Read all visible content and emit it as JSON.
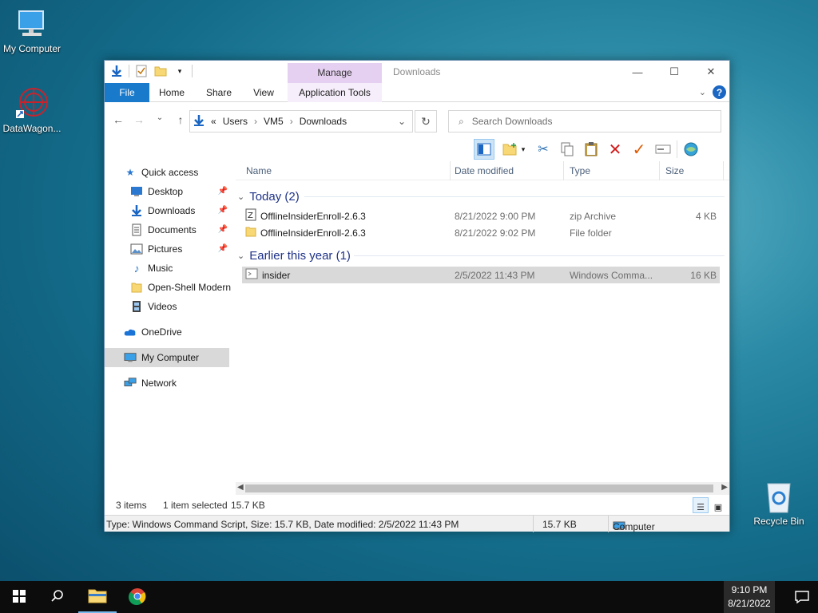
{
  "desktop": {
    "icons": [
      {
        "label": "My Computer"
      },
      {
        "label": "DataWagon..."
      },
      {
        "label": "Recycle Bin"
      }
    ]
  },
  "window": {
    "title": "Downloads",
    "context_tab_header": "Manage",
    "ribbon_tabs": [
      "File",
      "Home",
      "Share",
      "View",
      "Application Tools"
    ],
    "address": {
      "crumbs": [
        "«",
        "Users",
        "VM5",
        "Downloads"
      ]
    },
    "search": {
      "placeholder": "Search Downloads"
    },
    "nav_pane": [
      {
        "label": "Quick access",
        "icon": "star-icon"
      },
      {
        "label": "Desktop",
        "icon": "desktop-folder-icon",
        "pinned": true
      },
      {
        "label": "Downloads",
        "icon": "download-arrow-icon",
        "pinned": true
      },
      {
        "label": "Documents",
        "icon": "documents-icon",
        "pinned": true
      },
      {
        "label": "Pictures",
        "icon": "pictures-icon",
        "pinned": true
      },
      {
        "label": "Music",
        "icon": "music-note-icon"
      },
      {
        "label": "Open-Shell Modern",
        "icon": "folder-icon"
      },
      {
        "label": "Videos",
        "icon": "film-icon"
      },
      {
        "label": "OneDrive",
        "icon": "cloud-icon"
      },
      {
        "label": "My Computer",
        "icon": "computer-icon"
      },
      {
        "label": "Network",
        "icon": "network-icon"
      }
    ],
    "columns": [
      "Name",
      "Date modified",
      "Type",
      "Size"
    ],
    "groups": [
      {
        "label": "Today (2)",
        "rows": [
          {
            "name": "OfflineInsiderEnroll-2.6.3",
            "date": "8/21/2022 9:00 PM",
            "type": "zip Archive",
            "size": "4 KB",
            "icon": "zip-icon"
          },
          {
            "name": "OfflineInsiderEnroll-2.6.3",
            "date": "8/21/2022 9:02 PM",
            "type": "File folder",
            "size": "",
            "icon": "folder-icon"
          }
        ]
      },
      {
        "label": "Earlier this year (1)",
        "rows": [
          {
            "name": "insider",
            "date": "2/5/2022 11:43 PM",
            "type": "Windows Comma...",
            "size": "16 KB",
            "icon": "script-icon"
          }
        ]
      }
    ],
    "status": {
      "items": "3 items",
      "selected": "1 item selected",
      "size": "15.7 KB"
    },
    "details": {
      "text": "Type: Windows Command Script, Size: 15.7 KB, Date modified: 2/5/2022 11:43 PM",
      "size": "15.7 KB",
      "location": "Computer"
    }
  },
  "taskbar": {
    "time": "9:10 PM",
    "date": "8/21/2022"
  }
}
